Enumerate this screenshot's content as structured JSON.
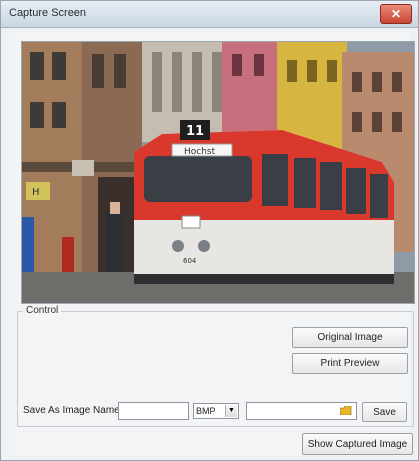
{
  "window": {
    "title": "Capture Screen",
    "close_symbol": "✕"
  },
  "control": {
    "group_label": "Control",
    "original_image_label": "Original Image",
    "print_preview_label": "Print Preview",
    "save_as_label": "Save As Image Name :",
    "image_name_value": "",
    "format_value": "BMP",
    "path_value": "",
    "save_label": "Save",
    "show_captured_label": "Show Captured Image"
  },
  "preview": {
    "image_desc_icon": "tram-photo",
    "tram_number": "11",
    "tram_destination": "Hochst",
    "tram_plate": "604"
  }
}
